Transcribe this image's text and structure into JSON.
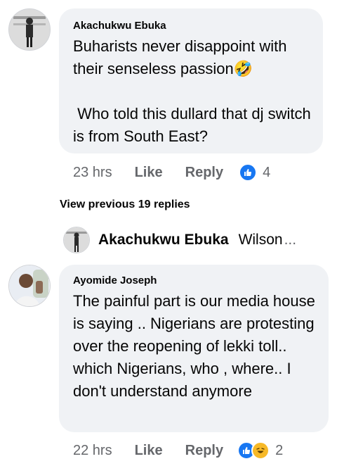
{
  "comments": [
    {
      "author": "Akachukwu Ebuka",
      "text": "Buharists never disappoint with their senseless passion🤣\n\n Who told this dullard that dj switch is from South East?",
      "time": "23 hrs",
      "like_label": "Like",
      "reply_label": "Reply",
      "reaction_count": "4",
      "reactions": [
        "like-icon"
      ]
    },
    {
      "author": "Ayomide Joseph",
      "text": "The painful part is our media house is saying .. Nigerians are protesting over the reopening of lekki toll.. which Nigerians, who , where.. I don't understand anymore",
      "time": "22 hrs",
      "like_label": "Like",
      "reply_label": "Reply",
      "reaction_count": "2",
      "reactions": [
        "like-icon",
        "haha-icon"
      ]
    }
  ],
  "replies_thread": {
    "view_previous_label": "View previous 19 replies",
    "latest_reply_author": "Akachukwu Ebuka",
    "latest_reply_preview": "Wilson",
    "ellipsis": "..."
  },
  "colors": {
    "bubble": "#f0f2f5",
    "meta_text": "#65676b",
    "like_blue": "#1877f2",
    "haha_yellow": "#f7b928"
  }
}
